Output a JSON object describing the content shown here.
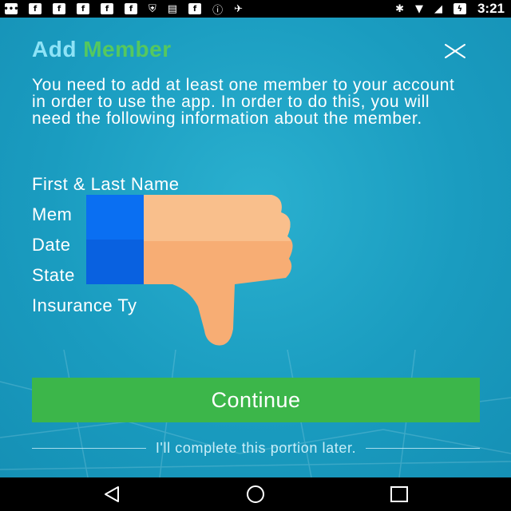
{
  "status_bar": {
    "time": "3:21",
    "left_icons": [
      "message-icon",
      "facebook-icon",
      "facebook-icon",
      "facebook-icon",
      "facebook-icon",
      "facebook-icon",
      "shield-icon",
      "notes-icon",
      "facebook-icon",
      "info-icon",
      "location-off-icon"
    ],
    "right_icons": [
      "bluetooth-icon",
      "wifi-icon",
      "signal-icon",
      "battery-icon"
    ]
  },
  "dialog": {
    "title_part1": "Add",
    "title_part2": "Member",
    "intro": "You need to add at least one member to your account in order to use the app. In order to do this, you will need the following information about the member.",
    "requirements": [
      "First & Last Name",
      "Mem",
      "Date",
      "State",
      "Insurance Ty"
    ],
    "continue_label": "Continue",
    "later_label": "I'll complete this portion later."
  },
  "overlay": {
    "icon": "thumbs-down-icon"
  },
  "colors": {
    "background": "#1a9cc0",
    "title_add": "#8ee3f7",
    "title_member": "#55c85f",
    "button": "#3cb64a"
  }
}
